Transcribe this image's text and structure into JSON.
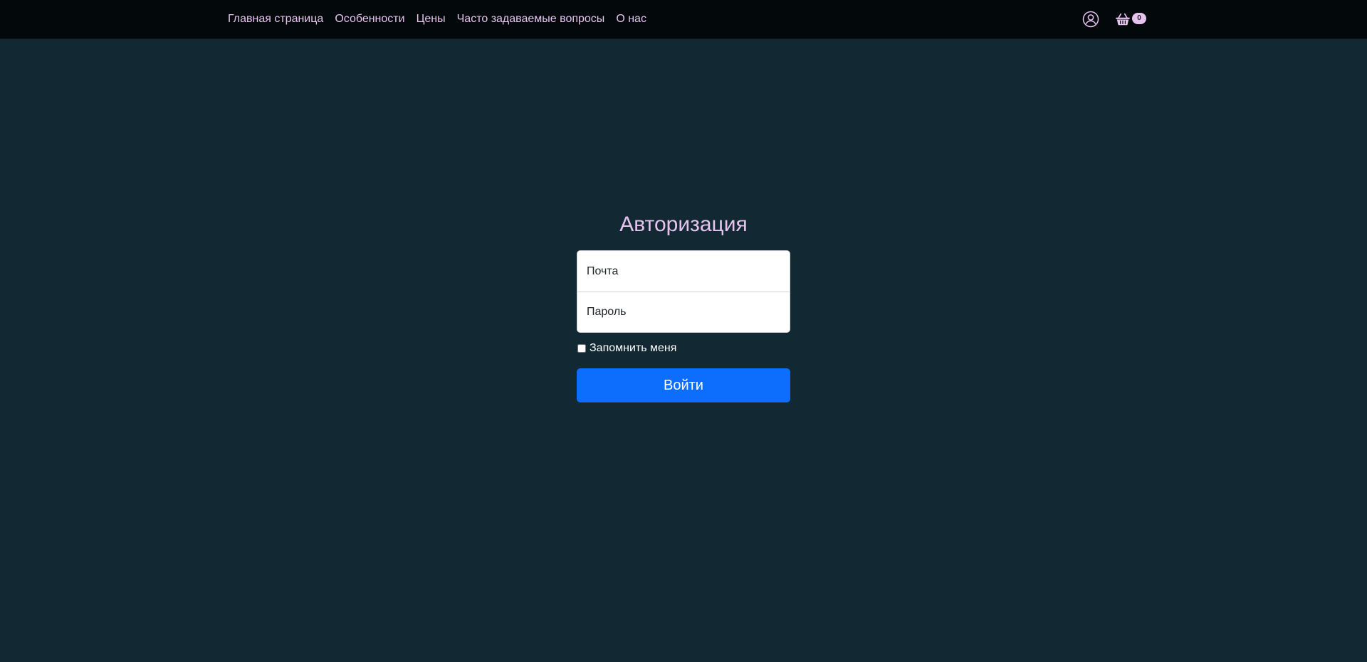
{
  "colors": {
    "background": "#122833",
    "navbar": "#03080b",
    "accent": "#e6c2ee",
    "primary_button": "#0d6efd"
  },
  "navbar": {
    "links": [
      {
        "label": "Главная страница"
      },
      {
        "label": "Особенности"
      },
      {
        "label": "Цены"
      },
      {
        "label": "Часто задаваемые вопросы"
      },
      {
        "label": "О нас"
      }
    ],
    "icons": {
      "user": "user-circle-icon",
      "cart": "basket-icon"
    },
    "cart_count": "0"
  },
  "auth": {
    "title": "Авторизация",
    "email_placeholder": "Почта",
    "password_placeholder": "Пароль",
    "remember_label": "Запомнить меня",
    "remember_checked": false,
    "submit_label": "Войти"
  }
}
